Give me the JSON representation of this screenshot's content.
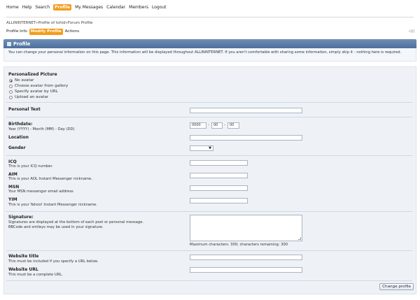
{
  "nav": {
    "items": [
      "Home",
      "Help",
      "Search",
      "Profile",
      "My Messages",
      "Calendar",
      "Members",
      "Logout"
    ],
    "active_index": 3
  },
  "breadcrumb": [
    "ALLININTERNET",
    " » ",
    "Profile of tohid",
    " » ",
    "Forum Profile"
  ],
  "subtabs": {
    "items": [
      "Profile Info",
      "Modify Profile",
      "Actions"
    ],
    "active_index": 1,
    "collapse_glyph": "◁◁"
  },
  "section_title": "Profile",
  "info_text": "You can change your personal information on this page. This information will be displayed throughout ALLININTERNET. If you aren't comfortable with sharing some information, simply skip it - nothing here is required.",
  "form": {
    "avatar": {
      "label": "Personalized Picture",
      "options": [
        "No avatar",
        "Choose avatar from gallery",
        "Specify avatar by URL",
        "Upload an avatar"
      ],
      "selected_index": 0
    },
    "personal_text": {
      "label": "Personal Text",
      "value": ""
    },
    "birthdate": {
      "label": "Birthdate:",
      "hint": "Year (YYYY) - Month (MM) - Day (DD)",
      "year": "0000",
      "month": "00",
      "day": "00",
      "sep": "-"
    },
    "location": {
      "label": "Location",
      "value": ""
    },
    "gender": {
      "label": "Gender",
      "value": "",
      "arrow": "▼"
    },
    "icq": {
      "label": "ICQ",
      "hint": "This is your ICQ number.",
      "value": ""
    },
    "aim": {
      "label": "AIM",
      "hint": "This is your AOL Instant Messenger nickname.",
      "value": ""
    },
    "msn": {
      "label": "MSN",
      "hint": "Your MSN messenger email address",
      "value": ""
    },
    "yim": {
      "label": "YIM",
      "hint": "This is your Yahoo! Instant Messenger nickname.",
      "value": ""
    },
    "signature": {
      "label": "Signature:",
      "hint1": "Signatures are displayed at the bottom of each post or personal message.",
      "hint2": "BBCode and smileys may be used in your signature.",
      "counter": "Maximum characters: 300; characters remaining: 300"
    },
    "website_title": {
      "label": "Website title",
      "hint": "This must be included if you specify a URL below.",
      "value": ""
    },
    "website_url": {
      "label": "Website URL",
      "hint": "This must be a complete URL.",
      "value": ""
    },
    "submit_label": "Change profile"
  },
  "colors": {
    "accent": "#f39c1b",
    "titlebar": "#5b7aa6",
    "panel": "#eef2f6"
  }
}
